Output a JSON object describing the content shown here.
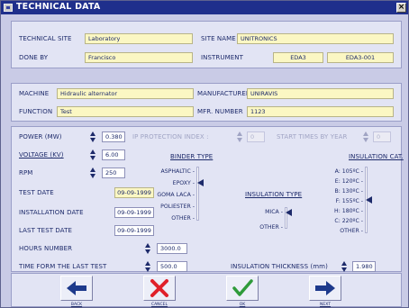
{
  "window": {
    "title": "TECHNICAL DATA"
  },
  "site": {
    "technical_site_label": "TECHNICAL SITE",
    "technical_site_value": "Laboratory",
    "site_name_label": "SITE NAME",
    "site_name_value": "UNITRONICS",
    "done_by_label": "DONE BY",
    "done_by_value": "Francisco",
    "instrument_label": "INSTRUMENT",
    "instrument_value_1": "EDA3",
    "instrument_value_2": "EDA3-001"
  },
  "machine": {
    "machine_label": "MACHINE",
    "machine_value": "Hidraulic alternator",
    "manufacturer_label": "MANUFACTURER",
    "manufacturer_value": "UNIRAVIS",
    "function_label": "FUNCTION",
    "function_value": "Test",
    "mfr_number_label": "MFR. NUMBER",
    "mfr_number_value": "1123"
  },
  "data": {
    "power_label": "POWER (MW)",
    "power_value": "0.380",
    "ip_label": "IP PROTECTION INDEX :",
    "ip_value": "0",
    "start_label": "START TIMES BY YEAR",
    "start_value": "0",
    "voltage_label": "VOLTAGE (KV)",
    "voltage_value": "6.00",
    "rpm_label": "RPM",
    "rpm_value": "250",
    "test_date_label": "TEST DATE",
    "test_date_value": "09-09-1999",
    "install_date_label": "INSTALLATION DATE",
    "install_date_value": "09-09-1999",
    "last_test_label": "LAST TEST DATE",
    "last_test_value": "09-09-1999",
    "hours_label": "HOURS NUMBER",
    "hours_value": "3000.0",
    "time_last_label": "TIME FORM THE LAST TEST",
    "time_last_value": "500.0",
    "ins_thick_label": "INSULATION THICKNESS (mm)",
    "ins_thick_value": "1.980"
  },
  "binder": {
    "title": "BINDER TYPE",
    "options": [
      "ASPHALTIC -",
      "EPOXY -",
      "GOMA LACA -",
      "POLIESTER -",
      "OTHER -"
    ],
    "selected": "EPOXY -"
  },
  "insulation_type": {
    "title": "INSULATION TYPE",
    "options": [
      "MICA -",
      "OTHER -"
    ],
    "selected": "MICA -"
  },
  "insulation_cat": {
    "title": "INSULATION CAT.",
    "options": [
      "A: 105ºC -",
      "E: 120ºC -",
      "B: 130ºC -",
      "F: 155ºC -",
      "H: 180ºC -",
      "C: 220ºC -",
      "OTHER -"
    ],
    "selected": "F: 155ºC -"
  },
  "nav": {
    "back": "BACK",
    "cancel": "CANCEL",
    "ok": "OK",
    "next": "NEXT"
  },
  "colors": {
    "title_bar": "#1f2f8c",
    "field_yellow": "#fbf7c3",
    "panel": "#e2e4f4",
    "accent_blue": "#1d3a8c",
    "cancel_red": "#e0202a",
    "ok_green": "#2f9b3a"
  }
}
